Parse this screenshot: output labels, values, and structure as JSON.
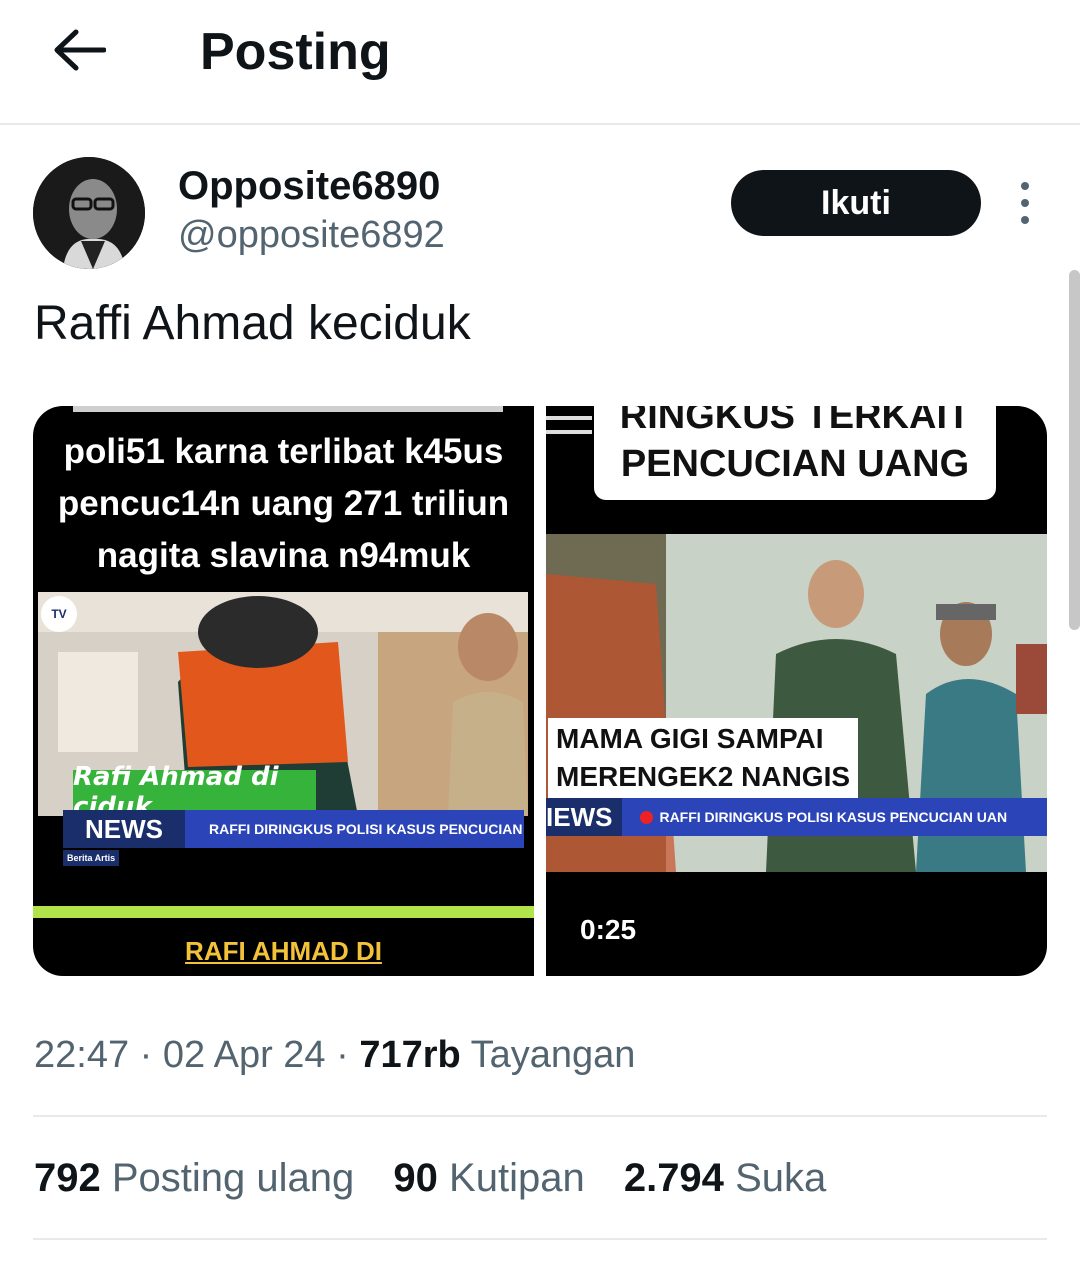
{
  "header": {
    "title": "Posting",
    "back_icon": "arrow-left-icon"
  },
  "author": {
    "display_name": "Opposite6890",
    "handle": "@opposite6892",
    "avatar": "avatar-photo"
  },
  "follow_label": "Ikuti",
  "more_icon": "more-vertical-icon",
  "tweet_text": "Raffi Ahmad keciduk",
  "media": {
    "left": {
      "caption_lines": [
        "poli51 karna terlibat k45us",
        "pencuc14n uang 271 triliun",
        "nagita slavina n94muk"
      ],
      "logo": "TV",
      "label": "Rafi Ahmad di ciduk",
      "news_tag": "NEWS",
      "ticker": "RAFFI DIRINGKUS POLISI KASUS PENCUCIAN UANG",
      "berita": "Berita Artis",
      "bottom_caption": "RAFI AHMAD DI"
    },
    "right": {
      "caption_lines": [
        "RINGKUS TERKAIT",
        "PENCUCIAN UANG"
      ],
      "box_lines": [
        "MAMA GIGI SAMPAI",
        "MERENGEK2 NANGIS"
      ],
      "news_tag": "IEWS",
      "ticker": "RAFFI DIRINGKUS POLISI KASUS PENCUCIAN UAN",
      "duration": "0:25"
    }
  },
  "meta": {
    "time": "22:47",
    "date": "02 Apr 24",
    "views": "717rb",
    "views_label": "Tayangan"
  },
  "stats": {
    "reposts": "792",
    "reposts_label": "Posting ulang",
    "quotes": "90",
    "quotes_label": "Kutipan",
    "likes": "2.794",
    "likes_label": "Suka"
  },
  "colors": {
    "text": "#0f1419",
    "secondary": "#536471",
    "follow_bg": "#0f1419",
    "divider": "#e7e9ea"
  }
}
